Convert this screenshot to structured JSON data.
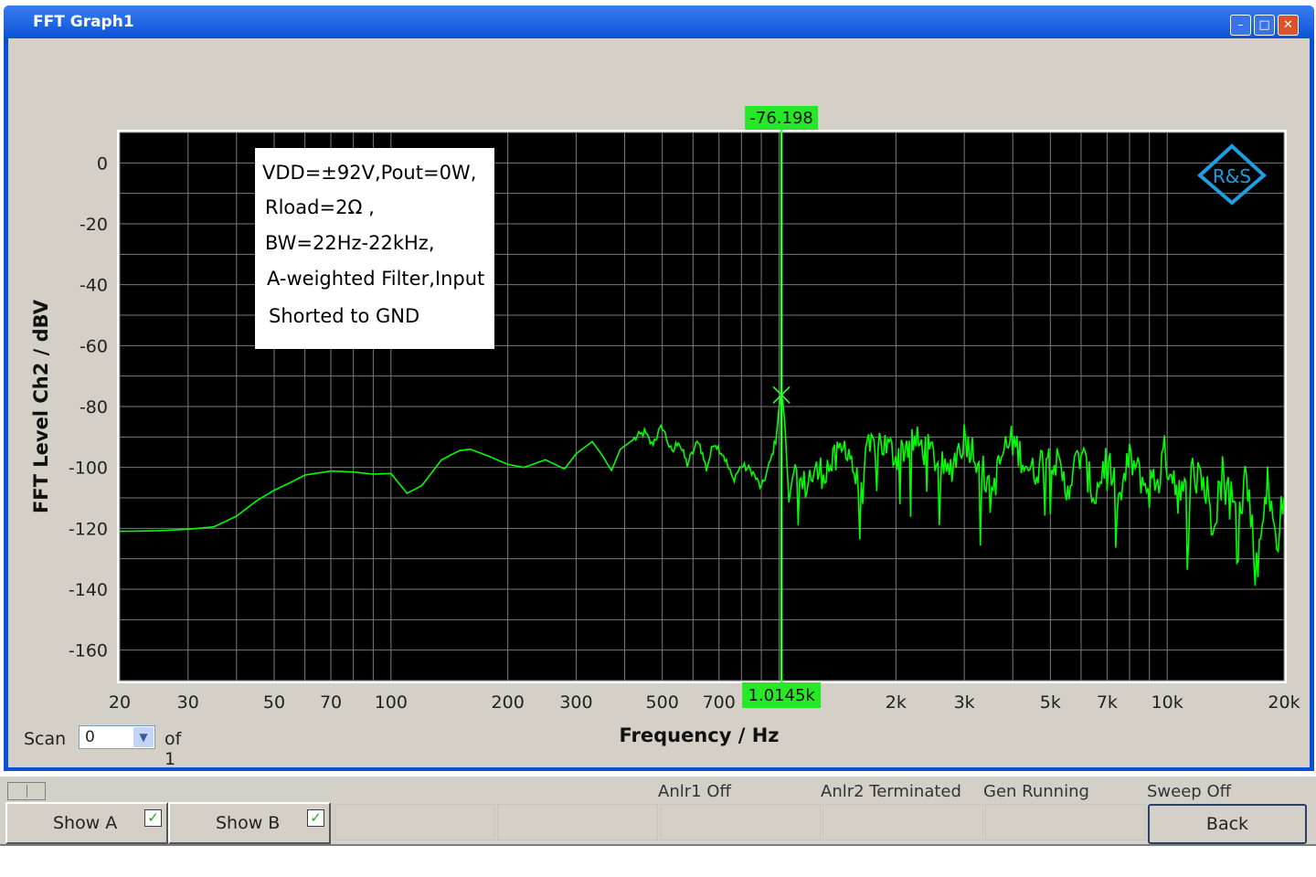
{
  "window": {
    "title": "FFT Graph1",
    "controls": {
      "minimize": "minimize-icon",
      "maximize": "maximize-icon",
      "close": "close-icon"
    }
  },
  "colors": {
    "trace": "#00ff00",
    "plot_bg": "#000000",
    "grid": "#7a7a7a",
    "logo": "#1e9ee0",
    "marker_bg": "#27e827"
  },
  "annotation": {
    "lines": [
      "VDD=±92V,Pout=0W,",
      "Rload=2Ω ,",
      "BW=22Hz-22kHz,",
      "A-weighted Filter,Input",
      "Shorted to GND"
    ]
  },
  "logo": {
    "text": "R&S",
    "icon": "rs-logo-icon"
  },
  "chart_data": {
    "type": "line",
    "xscale": "log",
    "xlim": [
      20,
      20000
    ],
    "ylim": [
      -170,
      10
    ],
    "ylabel": "FFT Level Ch2 / dBV",
    "xlabel": "Frequency / Hz",
    "xticks": [
      {
        "v": 20,
        "label": "20"
      },
      {
        "v": 30,
        "label": "30"
      },
      {
        "v": 50,
        "label": "50"
      },
      {
        "v": 70,
        "label": "70"
      },
      {
        "v": 100,
        "label": "100"
      },
      {
        "v": 200,
        "label": "200"
      },
      {
        "v": 300,
        "label": "300"
      },
      {
        "v": 500,
        "label": "500"
      },
      {
        "v": 700,
        "label": "700"
      },
      {
        "v": 2000,
        "label": "2k"
      },
      {
        "v": 3000,
        "label": "3k"
      },
      {
        "v": 5000,
        "label": "5k"
      },
      {
        "v": 7000,
        "label": "7k"
      },
      {
        "v": 10000,
        "label": "10k"
      },
      {
        "v": 20000,
        "label": "20k"
      }
    ],
    "yticks": [
      {
        "v": 0,
        "label": "0"
      },
      {
        "v": -20,
        "label": "-20"
      },
      {
        "v": -40,
        "label": "-40"
      },
      {
        "v": -60,
        "label": "-60"
      },
      {
        "v": -80,
        "label": "-80"
      },
      {
        "v": -100,
        "label": "-100"
      },
      {
        "v": -120,
        "label": "-120"
      },
      {
        "v": -140,
        "label": "-140"
      },
      {
        "v": -160,
        "label": "-160"
      }
    ],
    "grid": true,
    "marker": {
      "x": 1014.5,
      "y": -76.198,
      "x_label": "1.0145k",
      "y_label": "-76.198"
    },
    "series": [
      {
        "points": [
          [
            20,
            -121
          ],
          [
            25,
            -120.8
          ],
          [
            30,
            -120.3
          ],
          [
            35,
            -119.5
          ],
          [
            40,
            -116
          ],
          [
            45,
            -111
          ],
          [
            50,
            -107.5
          ],
          [
            55,
            -105
          ],
          [
            60,
            -102.5
          ],
          [
            70,
            -101.2
          ],
          [
            80,
            -101.5
          ],
          [
            90,
            -102.2
          ],
          [
            100,
            -102
          ],
          [
            110,
            -108.5
          ],
          [
            120,
            -106
          ],
          [
            135,
            -97.5
          ],
          [
            150,
            -94.5
          ],
          [
            160,
            -94
          ],
          [
            180,
            -96.5
          ],
          [
            200,
            -99
          ],
          [
            220,
            -100
          ],
          [
            250,
            -97.5
          ],
          [
            280,
            -100.5
          ],
          [
            300,
            -95.5
          ],
          [
            330,
            -91.5
          ],
          [
            350,
            -96
          ],
          [
            370,
            -101
          ],
          [
            390,
            -94
          ],
          [
            420,
            -91
          ],
          [
            450,
            -88.5
          ],
          [
            470,
            -92.5
          ],
          [
            500,
            -86.5
          ],
          [
            530,
            -95.5
          ],
          [
            550,
            -91
          ],
          [
            580,
            -99
          ],
          [
            620,
            -91
          ],
          [
            650,
            -100.5
          ],
          [
            680,
            -91.5
          ],
          [
            720,
            -96
          ],
          [
            760,
            -104
          ],
          [
            800,
            -99.5
          ],
          [
            850,
            -101
          ],
          [
            900,
            -107
          ],
          [
            950,
            -98
          ],
          [
            980,
            -91
          ],
          [
            1000,
            -80
          ],
          [
            1014.5,
            -76.2
          ],
          [
            1030,
            -82
          ],
          [
            1060,
            -110
          ],
          [
            1100,
            -100.5
          ],
          [
            1150,
            -107
          ],
          [
            1200,
            -103
          ],
          [
            1300,
            -101
          ],
          [
            1400,
            -98
          ],
          [
            1500,
            -92
          ],
          [
            1600,
            -107
          ],
          [
            1700,
            -95
          ],
          [
            1800,
            -91
          ],
          [
            2000,
            -96
          ],
          [
            2200,
            -91
          ],
          [
            2500,
            -96
          ],
          [
            2700,
            -103
          ],
          [
            3000,
            -90
          ],
          [
            3300,
            -98
          ],
          [
            3500,
            -110
          ],
          [
            3800,
            -94
          ],
          [
            4000,
            -91.5
          ],
          [
            4500,
            -102
          ],
          [
            5000,
            -94
          ],
          [
            5500,
            -107
          ],
          [
            6000,
            -95
          ],
          [
            6500,
            -110
          ],
          [
            7000,
            -96
          ],
          [
            7500,
            -112
          ],
          [
            8000,
            -97
          ],
          [
            9000,
            -108
          ],
          [
            10000,
            -96
          ],
          [
            11000,
            -112
          ],
          [
            12000,
            -98
          ],
          [
            13000,
            -115
          ],
          [
            14000,
            -102
          ],
          [
            15000,
            -116
          ],
          [
            16000,
            -102
          ],
          [
            17000,
            -135
          ],
          [
            18000,
            -104
          ],
          [
            19000,
            -124
          ],
          [
            20000,
            -110
          ]
        ]
      }
    ]
  },
  "scan": {
    "label": "Scan",
    "value": "0",
    "of_text": "of 1"
  },
  "status": {
    "anlr1": "Anlr1 Off",
    "anlr2": "Anlr2 Terminated",
    "gen": "Gen Running",
    "sweep": "Sweep Off"
  },
  "buttons": {
    "show_a": "Show A",
    "show_b": "Show B",
    "back": "Back"
  }
}
